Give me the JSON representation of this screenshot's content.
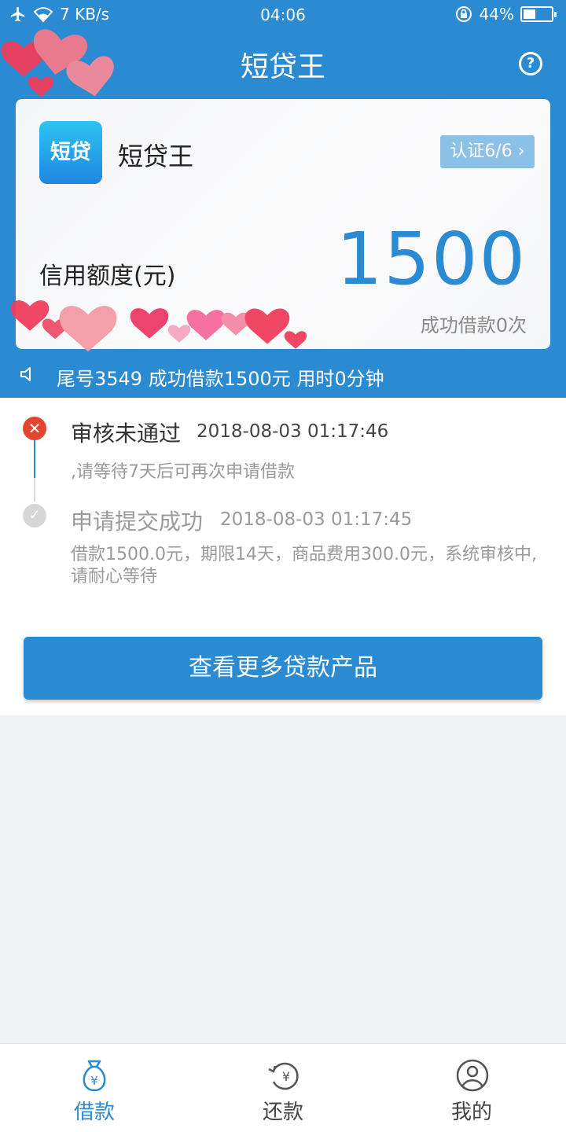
{
  "status_bar": {
    "network_speed": "7 KB/s",
    "time": "04:06",
    "battery_percent": "44%",
    "battery_level": 0.44
  },
  "header": {
    "title": "短贷王",
    "help_icon": "question-icon"
  },
  "card": {
    "logo_text": "短贷",
    "app_name": "短贷王",
    "badge": "认证6/6",
    "credit_label": "信用额度(元)",
    "credit_amount": "1500",
    "success_count": "成功借款0次"
  },
  "notice": {
    "text": "尾号3549 成功借款1500元 用时0分钟"
  },
  "timeline": [
    {
      "title": "审核未通过",
      "time": "2018-08-03 01:17:46",
      "desc": ",请等待7天后可再次申请借款",
      "status": "failed"
    },
    {
      "title": "申请提交成功",
      "time": "2018-08-03 01:17:45",
      "desc": "借款1500.0元，期限14天，商品费用300.0元，系统审核中,请耐心等待",
      "status": "done"
    }
  ],
  "more_button": "查看更多贷款产品",
  "tabs": [
    {
      "label": "借款",
      "icon": "money-bag-icon",
      "active": true
    },
    {
      "label": "还款",
      "icon": "refresh-yuan-icon",
      "active": false
    },
    {
      "label": "我的",
      "icon": "user-icon",
      "active": false
    }
  ],
  "colors": {
    "primary": "#2a8ad2",
    "error": "#e5452f",
    "muted": "#9a9a9a"
  }
}
